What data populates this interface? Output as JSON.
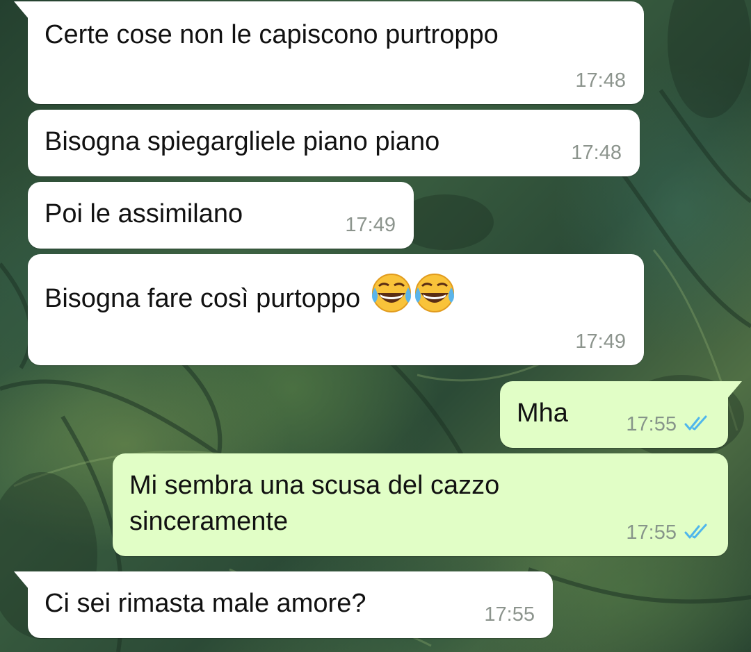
{
  "messages": [
    {
      "direction": "incoming",
      "text": "Certe cose non le capiscono purtroppo",
      "time": "17:48"
    },
    {
      "direction": "incoming",
      "text": "Bisogna spiegargliele piano piano",
      "time": "17:48"
    },
    {
      "direction": "incoming",
      "text": "Poi le assimilano",
      "time": "17:49"
    },
    {
      "direction": "incoming",
      "text": "Bisogna fare così purtoppo",
      "emoji": [
        "face-with-tears-of-joy",
        "face-with-tears-of-joy"
      ],
      "time": "17:49"
    },
    {
      "direction": "outgoing",
      "text": "Mha",
      "time": "17:55",
      "status": "read-double-tick"
    },
    {
      "direction": "outgoing",
      "text_lines": [
        "Mi sembra una scusa del cazzo",
        "sinceramente"
      ],
      "time": "17:55",
      "status": "read-double-tick"
    },
    {
      "direction": "incoming",
      "text": "Ci sei rimasta male amore?",
      "time": "17:55"
    }
  ],
  "colors": {
    "incoming_bubble": "#ffffff",
    "outgoing_bubble": "#e1fec6",
    "read_tick": "#4fb6ec",
    "timestamp": "#8c948d"
  }
}
